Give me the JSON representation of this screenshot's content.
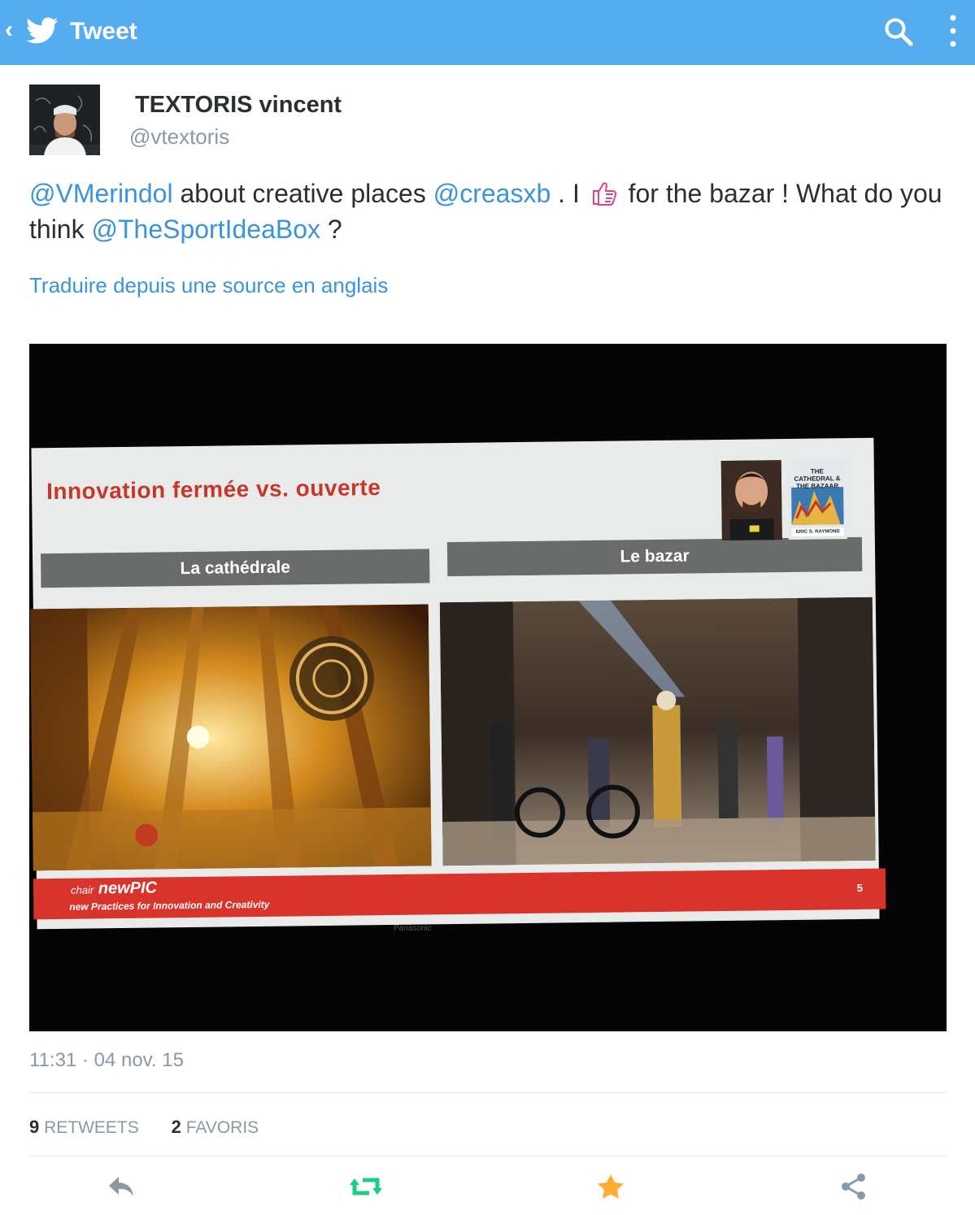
{
  "appbar": {
    "back_label": "‹",
    "title": "Tweet",
    "icons": [
      "twitter-bird-icon",
      "search-icon",
      "more-vertical-icon"
    ],
    "color": "#55acee"
  },
  "author": {
    "name": "TEXTORIS vincent",
    "handle": "@vtextoris"
  },
  "tweet": {
    "mention1": "@VMerindol",
    "text1": " about creative places ",
    "mention2": "@creasxb",
    "text2": " . I ",
    "emoji": "thumbs-up-icon",
    "text3": " for the bazar ! What do you think ",
    "mention3": "@TheSportIdeaBox",
    "text4": " ?"
  },
  "translate_label": "Traduire depuis une source en anglais",
  "media": {
    "slide_title": "Innovation fermée vs. ouverte",
    "left_bar": "La cathédrale",
    "right_bar": "Le bazar",
    "book_title": "THE CATHEDRAL & THE BAZAAR",
    "book_author": "ERIC S. RAYMOND",
    "footer_chair": "chair",
    "footer_name": "newPIC",
    "footer_subtitle": "new Practices for Innovation and Creativity",
    "slide_number": "5",
    "projector_brand": "Panasonic"
  },
  "timestamp": "11:31 · 04 nov. 15",
  "stats": {
    "retweets_count": "9",
    "retweets_label": "RETWEETS",
    "favorites_count": "2",
    "favorites_label": "FAVORIS"
  },
  "actions": [
    "reply-icon",
    "retweet-icon",
    "favorite-star-icon",
    "share-icon"
  ],
  "colors": {
    "link": "#3b94d9",
    "muted": "#8899a6",
    "retweet": "#19cf86",
    "favorite": "#ffac33"
  }
}
